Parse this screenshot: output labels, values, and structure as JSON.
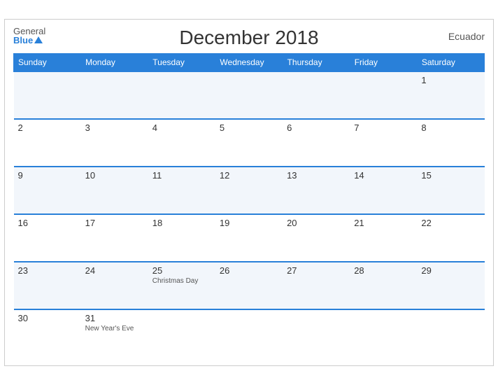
{
  "header": {
    "title": "December 2018",
    "country": "Ecuador",
    "logo_general": "General",
    "logo_blue": "Blue"
  },
  "weekdays": [
    "Sunday",
    "Monday",
    "Tuesday",
    "Wednesday",
    "Thursday",
    "Friday",
    "Saturday"
  ],
  "weeks": [
    [
      {
        "day": "",
        "holiday": ""
      },
      {
        "day": "",
        "holiday": ""
      },
      {
        "day": "",
        "holiday": ""
      },
      {
        "day": "",
        "holiday": ""
      },
      {
        "day": "",
        "holiday": ""
      },
      {
        "day": "",
        "holiday": ""
      },
      {
        "day": "1",
        "holiday": ""
      }
    ],
    [
      {
        "day": "2",
        "holiday": ""
      },
      {
        "day": "3",
        "holiday": ""
      },
      {
        "day": "4",
        "holiday": ""
      },
      {
        "day": "5",
        "holiday": ""
      },
      {
        "day": "6",
        "holiday": ""
      },
      {
        "day": "7",
        "holiday": ""
      },
      {
        "day": "8",
        "holiday": ""
      }
    ],
    [
      {
        "day": "9",
        "holiday": ""
      },
      {
        "day": "10",
        "holiday": ""
      },
      {
        "day": "11",
        "holiday": ""
      },
      {
        "day": "12",
        "holiday": ""
      },
      {
        "day": "13",
        "holiday": ""
      },
      {
        "day": "14",
        "holiday": ""
      },
      {
        "day": "15",
        "holiday": ""
      }
    ],
    [
      {
        "day": "16",
        "holiday": ""
      },
      {
        "day": "17",
        "holiday": ""
      },
      {
        "day": "18",
        "holiday": ""
      },
      {
        "day": "19",
        "holiday": ""
      },
      {
        "day": "20",
        "holiday": ""
      },
      {
        "day": "21",
        "holiday": ""
      },
      {
        "day": "22",
        "holiday": ""
      }
    ],
    [
      {
        "day": "23",
        "holiday": ""
      },
      {
        "day": "24",
        "holiday": ""
      },
      {
        "day": "25",
        "holiday": "Christmas Day"
      },
      {
        "day": "26",
        "holiday": ""
      },
      {
        "day": "27",
        "holiday": ""
      },
      {
        "day": "28",
        "holiday": ""
      },
      {
        "day": "29",
        "holiday": ""
      }
    ],
    [
      {
        "day": "30",
        "holiday": ""
      },
      {
        "day": "31",
        "holiday": "New Year's Eve"
      },
      {
        "day": "",
        "holiday": ""
      },
      {
        "day": "",
        "holiday": ""
      },
      {
        "day": "",
        "holiday": ""
      },
      {
        "day": "",
        "holiday": ""
      },
      {
        "day": "",
        "holiday": ""
      }
    ]
  ]
}
